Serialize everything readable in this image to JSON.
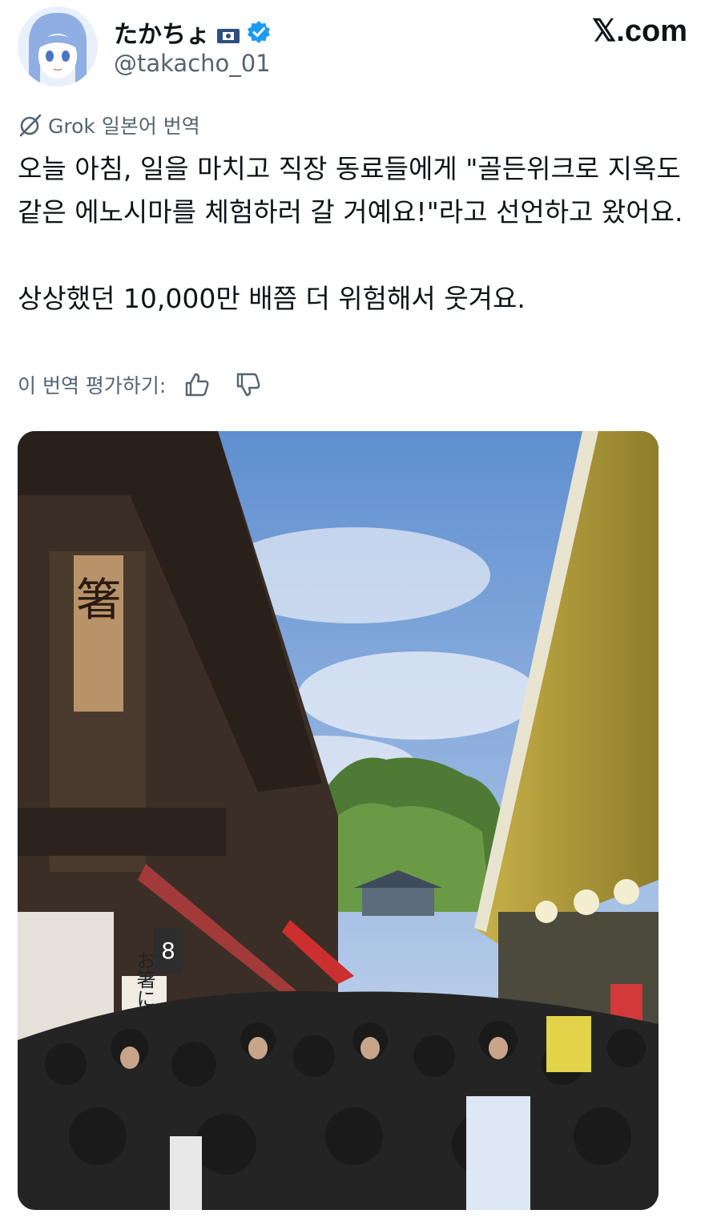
{
  "tweet": {
    "display_name": "たかちょ",
    "handle": "@takacho_01",
    "brand": "𝕏.com",
    "translation_label": "Grok 일본어 번역",
    "text": "오늘 아침, 일을 마치고 직장 동료들에게 \"골든위크로 지옥도 같은 에노시마를 체험하러 갈 거예요!\"라고 선언하고 왔어요.\n\n상상했던 10,000만 배쯤 더 위험해서 웃겨요.",
    "rate_label": "이 번역 평가하기:"
  },
  "colors": {
    "verified": "#1d9bf0",
    "secondary_text": "#536471",
    "primary_text": "#0f1419"
  },
  "icons": {
    "verified": "verified-badge-icon",
    "grok": "grok-icon",
    "thumbs_up": "thumbs-up-icon",
    "thumbs_down": "thumbs-down-icon"
  },
  "photo": {
    "sign_chopsticks": "箸",
    "sign_vertical": "お箸にお名前",
    "sign_number": "8"
  }
}
